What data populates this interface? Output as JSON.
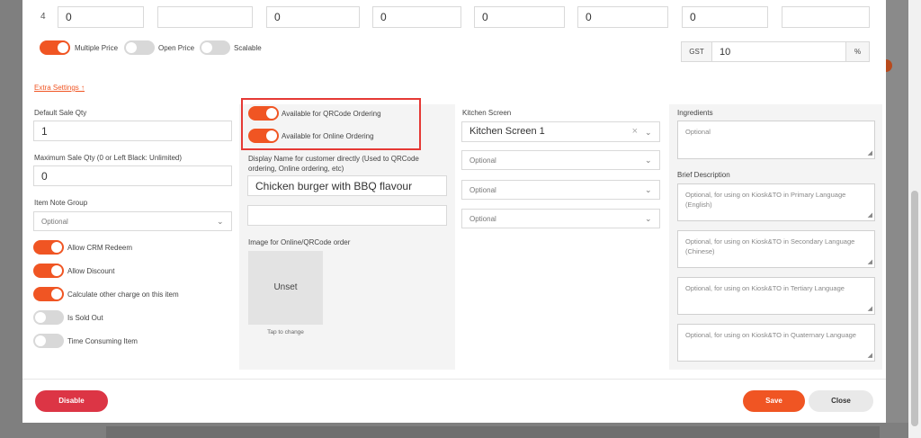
{
  "price_row": {
    "row_number": "4",
    "values": [
      "0",
      "",
      "0",
      "0",
      "0",
      "0",
      "0",
      ""
    ]
  },
  "pricing_toggles": [
    {
      "label": "Multiple Price",
      "on": true
    },
    {
      "label": "Open Price",
      "on": false
    },
    {
      "label": "Scalable",
      "on": false
    }
  ],
  "tax": {
    "label": "GST",
    "value": "10",
    "unit": "%"
  },
  "extra_settings_link": "Extra Settings ↑",
  "left": {
    "default_sale_qty": {
      "label": "Default Sale Qty",
      "value": "1"
    },
    "max_sale_qty": {
      "label": "Maximum Sale Qty (0 or Left Black: Unlimited)",
      "value": "0"
    },
    "item_note_group": {
      "label": "Item Note Group",
      "placeholder": "Optional"
    },
    "toggles": [
      {
        "label": "Allow CRM Redeem",
        "on": true
      },
      {
        "label": "Allow Discount",
        "on": true
      },
      {
        "label": "Calculate other charge on this item",
        "on": true
      },
      {
        "label": "Is Sold Out",
        "on": false
      },
      {
        "label": "Time Consuming Item",
        "on": false
      }
    ]
  },
  "middle": {
    "toggles": [
      {
        "label": "Available for QRCode Ordering",
        "on": true
      },
      {
        "label": "Available for Online Ordering",
        "on": true
      }
    ],
    "display_name_label": "Display Name for customer directly (Used to QRCode ordering, Online ordering, etc)",
    "display_name_value": "Chicken burger with BBQ flavour",
    "display_name_2": "",
    "image_label": "Image for Online/QRCode order",
    "image_placeholder": "Unset",
    "image_hint": "Tap to change"
  },
  "kitchen": {
    "label": "Kitchen Screen",
    "selected": "Kitchen Screen 1",
    "others": [
      "Optional",
      "Optional",
      "Optional"
    ]
  },
  "right": {
    "ingredients_label": "Ingredients",
    "ingredients_placeholder": "Optional",
    "brief_label": "Brief Description",
    "descriptions": [
      "Optional, for using on Kiosk&TO in Primary Language (English)",
      "Optional, for using on Kiosk&TO in Secondary Language (Chinese)",
      "Optional, for using on Kiosk&TO in Tertiary Language",
      "Optional, for using on Kiosk&TO in Quaternary Language"
    ]
  },
  "footer": {
    "disable": "Disable",
    "save": "Save",
    "close": "Close"
  },
  "colors": {
    "accent": "#f05523",
    "danger": "#dc3545",
    "highlight": "#e53935"
  }
}
